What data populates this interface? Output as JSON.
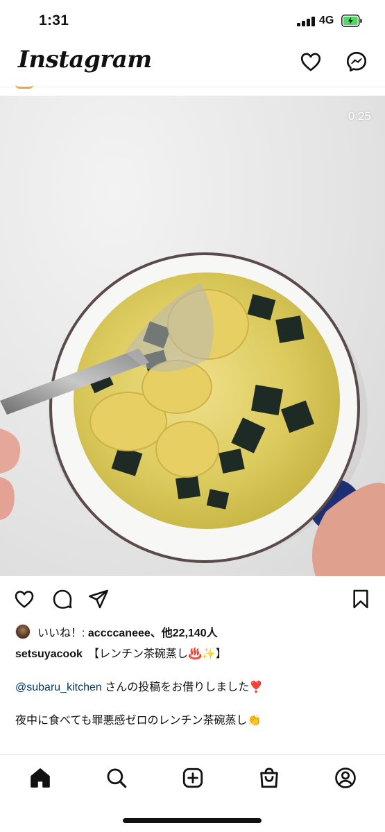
{
  "status_bar": {
    "time": "1:31",
    "network": "4G"
  },
  "header": {
    "logo": "Instagram",
    "icons": [
      "heart-icon",
      "messenger-icon"
    ]
  },
  "post": {
    "video_time": "0:25",
    "likes": {
      "prefix": "いいね！: ",
      "liker": "accccaneee",
      "suffix": "、他22,140人"
    },
    "caption": {
      "username": "setsuyacook",
      "title": "【レンチン茶碗蒸し♨️✨】",
      "mention": "@subaru_kitchen",
      "mention_suffix": " さんの投稿をお借りしました❣️",
      "body": "夜中に食べても罪悪感ゼロのレンチン茶碗蒸し👏"
    },
    "action_icons": [
      "heart-icon",
      "comment-icon",
      "send-icon",
      "bookmark-icon"
    ]
  },
  "tab_bar": {
    "icons": [
      "home-icon",
      "search-icon",
      "new-post-icon",
      "shop-icon",
      "profile-icon"
    ]
  },
  "colors": {
    "mention": "#00376b",
    "battery": "#4cd964",
    "story_ring": "#e8a93b"
  }
}
